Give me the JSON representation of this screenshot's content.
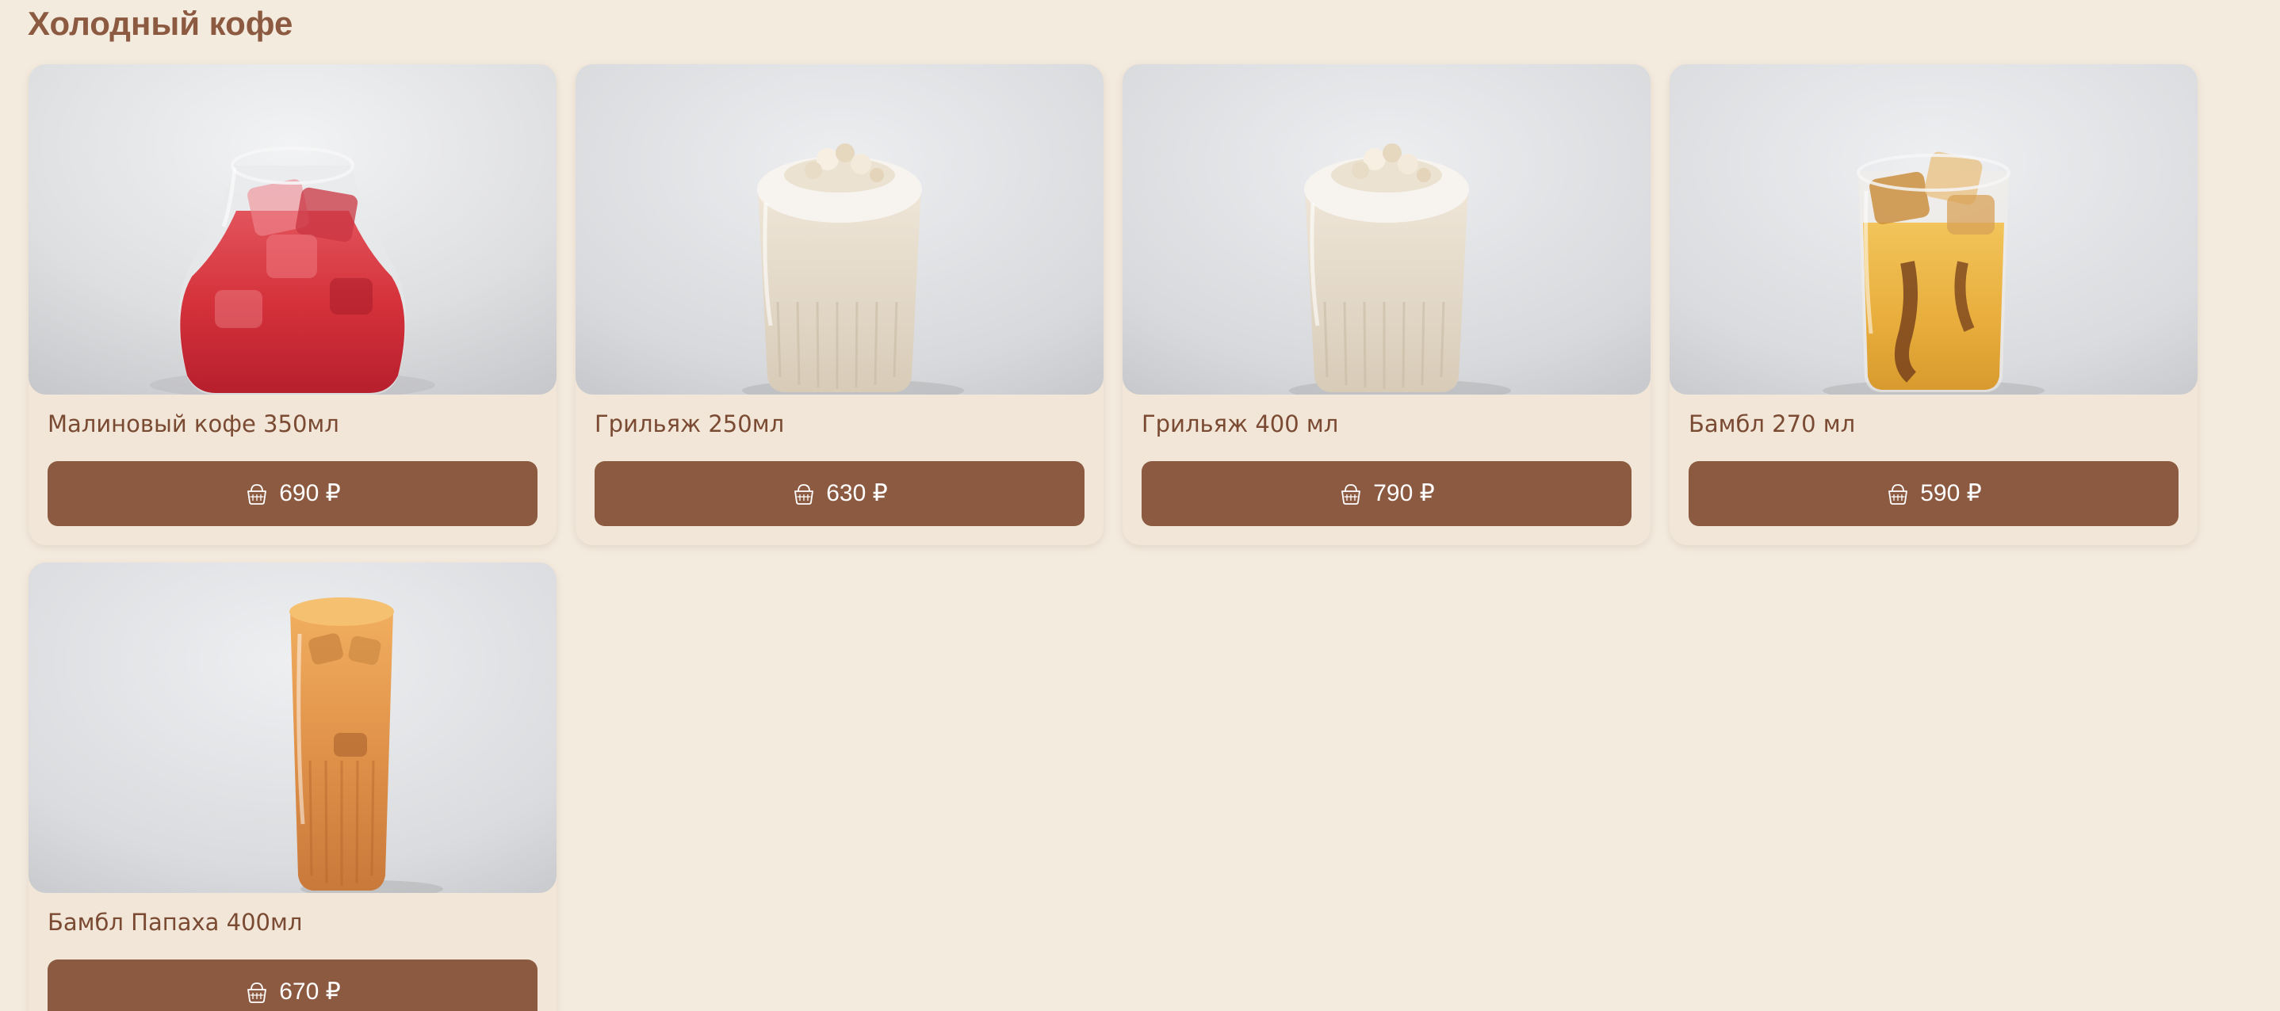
{
  "section": {
    "title": "Холодный кофе"
  },
  "products": [
    {
      "name": "Малиновый кофе 350мл",
      "price": "690 ₽",
      "icon": "basket-icon",
      "drink": "raspberry"
    },
    {
      "name": "Грильяж 250мл",
      "price": "630 ₽",
      "icon": "basket-icon",
      "drink": "cream"
    },
    {
      "name": "Грильяж 400 мл",
      "price": "790 ₽",
      "icon": "basket-icon",
      "drink": "cream"
    },
    {
      "name": "Бамбл 270 мл",
      "price": "590 ₽",
      "icon": "basket-icon",
      "drink": "orange-ice"
    },
    {
      "name": "Бамбл Папаха 400мл",
      "price": "670 ₽",
      "icon": "basket-icon",
      "drink": "caramel-tall"
    }
  ],
  "colors": {
    "page_background": "#f4ebdf",
    "card_background": "#f1e6d7",
    "accent": "#8c5a40",
    "title_text": "#8c5a40",
    "name_text": "#7a4a33",
    "button_text": "#ffffff"
  }
}
